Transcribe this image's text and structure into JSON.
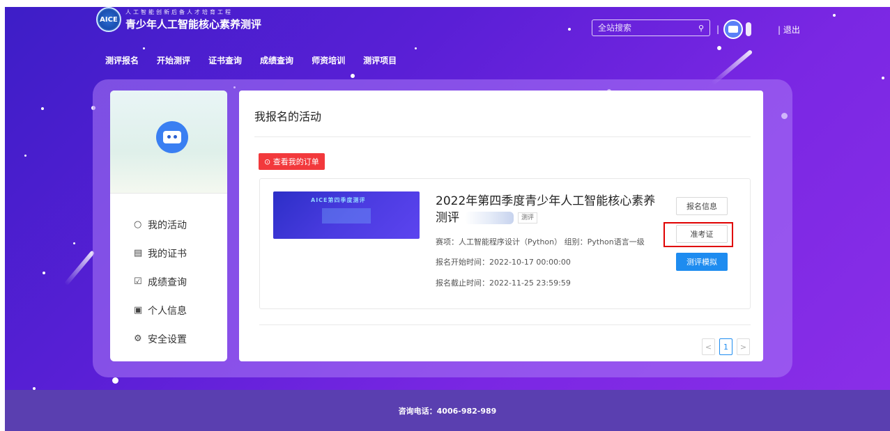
{
  "header": {
    "logo_badge": "AICE",
    "logo_subtitle": "人工智能创新后备人才培育工程",
    "logo_title": "青少年人工智能核心素养测评",
    "nav": [
      "测评报名",
      "开始测评",
      "证书查询",
      "成绩查询",
      "师资培训",
      "测评项目"
    ],
    "search_placeholder": "全站搜索",
    "search_icon": "search-icon",
    "separator": "|",
    "logout": "| 退出"
  },
  "sidebar": {
    "items": [
      {
        "icon": "○",
        "label": "我的活动"
      },
      {
        "icon": "▤",
        "label": "我的证书"
      },
      {
        "icon": "☑",
        "label": "成绩查询"
      },
      {
        "icon": "▣",
        "label": "个人信息"
      },
      {
        "icon": "⚙",
        "label": "安全设置"
      }
    ]
  },
  "content": {
    "title": "我报名的活动",
    "order_button": "⊙ 查看我的订单",
    "activity": {
      "banner_title": "AICE第四季度测评",
      "title": "2022年第四季度青少年人工智能核心素养测评",
      "tag": "测评",
      "category": "赛项：人工智能程序设计（Python） 组别：Python语言一级",
      "start_time": "报名开始时间：2022-10-17 00:00:00",
      "end_time": "报名截止时间：2022-11-25 23:59:59",
      "buttons": {
        "info": "报名信息",
        "admission": "准考证",
        "mock": "测评模拟"
      }
    },
    "pagination": {
      "prev": "<",
      "current": "1",
      "next": ">"
    }
  },
  "footer": {
    "contact": "咨询电话：4006-982-989"
  }
}
